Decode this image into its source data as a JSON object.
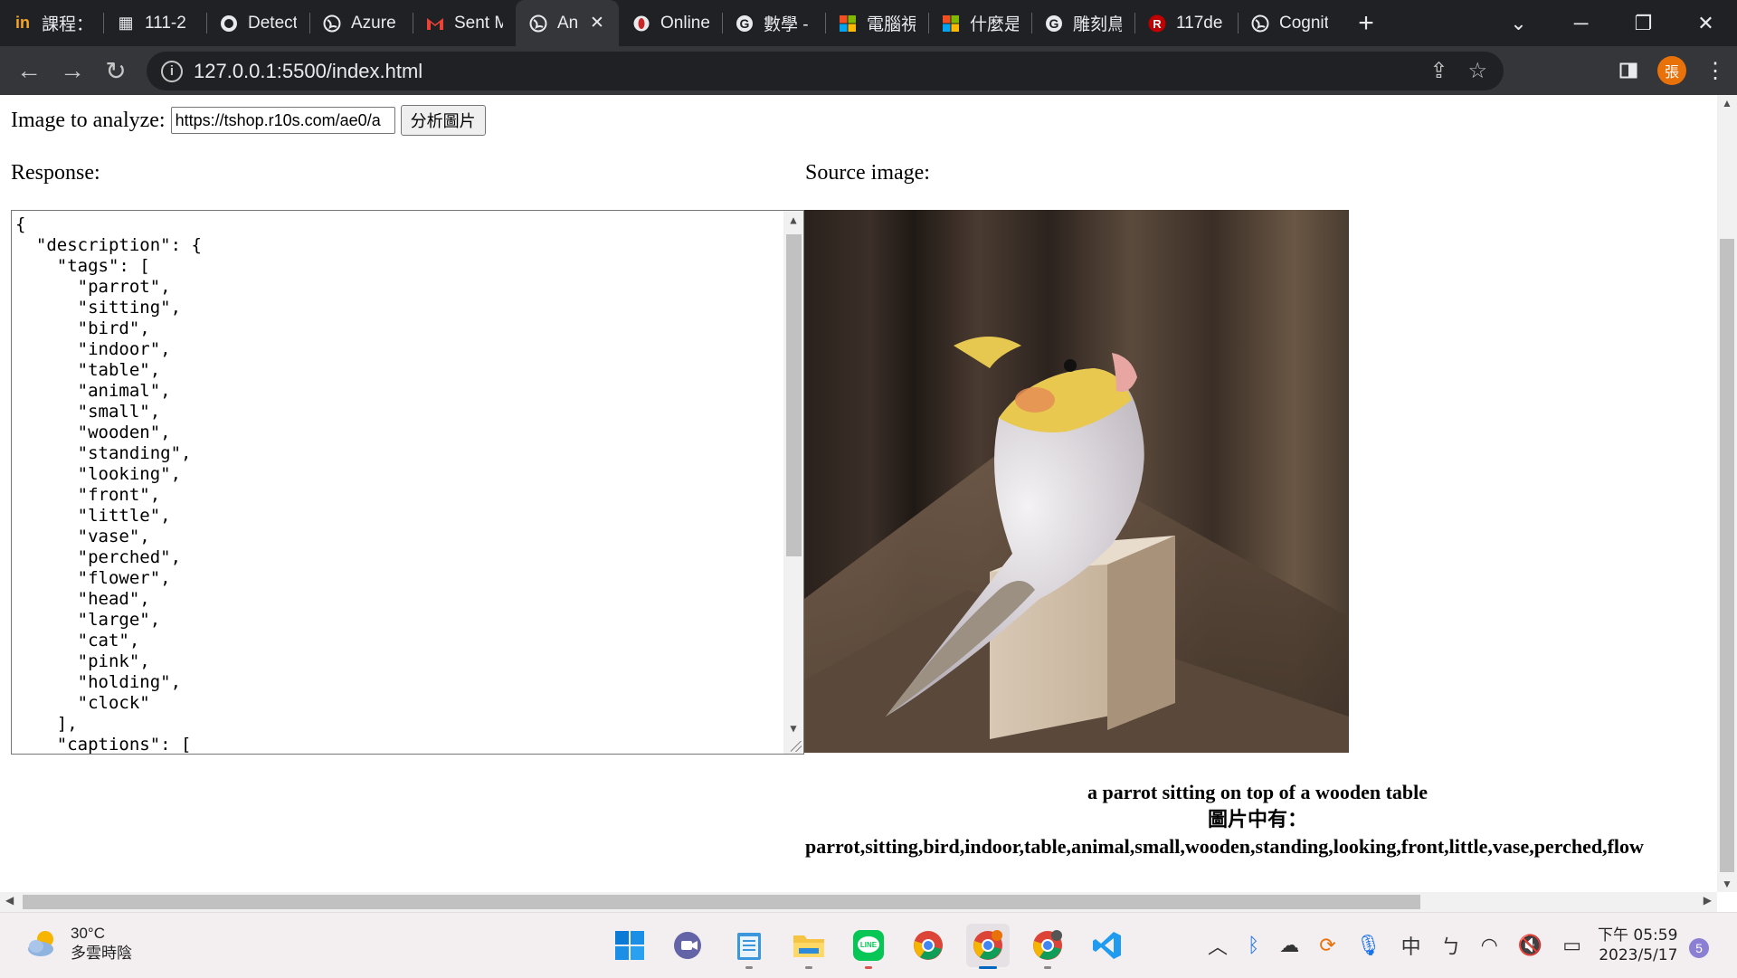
{
  "browser": {
    "tabs": [
      {
        "label": "課程：",
        "icon": "in-logo-icon",
        "active": false
      },
      {
        "label": "111-2",
        "icon": "pattern-icon",
        "active": false
      },
      {
        "label": "Detect",
        "icon": "github-icon",
        "active": false
      },
      {
        "label": "Azure",
        "icon": "globe-icon",
        "active": false
      },
      {
        "label": "Sent M",
        "icon": "gmail-icon",
        "active": false
      },
      {
        "label": "An",
        "icon": "globe-icon",
        "active": true
      },
      {
        "label": "Online",
        "icon": "opera-icon",
        "active": false
      },
      {
        "label": "數學 -",
        "icon": "google-icon",
        "active": false
      },
      {
        "label": "電腦視",
        "icon": "microsoft-icon",
        "active": false
      },
      {
        "label": "什麼是",
        "icon": "microsoft-icon",
        "active": false
      },
      {
        "label": "雕刻鳥",
        "icon": "google-icon",
        "active": false
      },
      {
        "label": "117de",
        "icon": "r-logo-icon",
        "active": false
      },
      {
        "label": "Cognit",
        "icon": "globe-icon",
        "active": false
      }
    ],
    "new_tab_label": "+",
    "url": "127.0.0.1:5500/index.html",
    "avatar_initial": "張"
  },
  "page": {
    "image_label": "Image to analyze:",
    "image_url_value": "https://tshop.r10s.com/ae0/a",
    "analyze_button": "分析圖片",
    "response_label": "Response:",
    "source_label": "Source image:",
    "response_json": "{\n  \"description\": {\n    \"tags\": [\n      \"parrot\",\n      \"sitting\",\n      \"bird\",\n      \"indoor\",\n      \"table\",\n      \"animal\",\n      \"small\",\n      \"wooden\",\n      \"standing\",\n      \"looking\",\n      \"front\",\n      \"little\",\n      \"vase\",\n      \"perched\",\n      \"flower\",\n      \"head\",\n      \"large\",\n      \"cat\",\n      \"pink\",\n      \"holding\",\n      \"clock\"\n    ],\n    \"captions\": [",
    "caption": "a parrot sitting on top of a wooden table",
    "tags_heading": "圖片中有：",
    "tags_line": "parrot,sitting,bird,indoor,table,animal,small,wooden,standing,looking,front,little,vase,perched,flow"
  },
  "taskbar": {
    "weather_temp": "30°C",
    "weather_desc": "多雲時陰",
    "apps": [
      "start",
      "teams",
      "notepad",
      "file-explorer",
      "line",
      "chrome",
      "chrome-active",
      "chrome-profile",
      "vscode"
    ],
    "ime_label": "中",
    "ime_mode": "ㄅ",
    "clock_time": "下午 05:59",
    "clock_date": "2023/5/17",
    "notification_count": "5"
  },
  "colors": {
    "tabbar_bg": "#202124",
    "toolbar_bg": "#35363a",
    "taskbar_bg": "#f3eef0",
    "avatar": "#e8710a"
  }
}
